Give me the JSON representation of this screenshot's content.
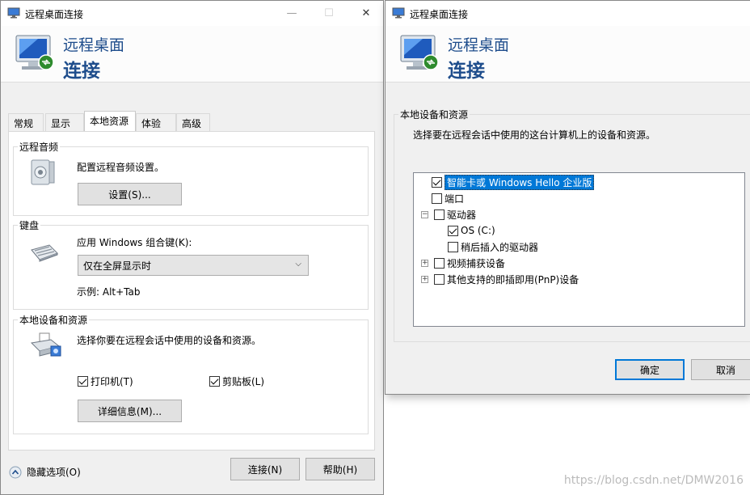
{
  "window_title": "远程桌面连接",
  "banner": {
    "line1": "远程桌面",
    "line2": "连接"
  },
  "main": {
    "tabs": [
      "常规",
      "显示",
      "本地资源",
      "体验",
      "高级"
    ],
    "audio": {
      "label": "远程音频",
      "desc": "配置远程音频设置。",
      "button": "设置(S)..."
    },
    "keyboard": {
      "label": "键盘",
      "desc": "应用 Windows 组合键(K):",
      "selected": "仅在全屏显示时",
      "example": "示例: Alt+Tab"
    },
    "devices": {
      "label": "本地设备和资源",
      "desc": "选择你要在远程会话中使用的设备和资源。",
      "printer": "打印机(T)",
      "clipboard": "剪贴板(L)",
      "more_button": "详细信息(M)..."
    },
    "hide_options": "隐藏选项(O)",
    "connect_button": "连接(N)",
    "help_button": "帮助(H)"
  },
  "dialog": {
    "group_label": "本地设备和资源",
    "desc": "选择要在远程会话中使用的这台计算机上的设备和资源。",
    "items": [
      {
        "label": "智能卡或 Windows Hello 企业版",
        "checked": true
      },
      {
        "label": "端口",
        "checked": false
      },
      {
        "label": "驱动器",
        "checked": false,
        "expander": "−"
      },
      {
        "label": "OS (C:)",
        "checked": true
      },
      {
        "label": "稍后插入的驱动器",
        "checked": false
      },
      {
        "label": "视频捕获设备",
        "checked": false,
        "expander": "+"
      },
      {
        "label": "其他支持的即插即用(PnP)设备",
        "checked": false,
        "expander": "+"
      }
    ],
    "ok_button": "确定",
    "cancel_button": "取消"
  },
  "watermark": "https://blog.csdn.net/DMW2016",
  "colors": {
    "accent": "#0078d7",
    "banner_text": "#1e4d8c"
  }
}
